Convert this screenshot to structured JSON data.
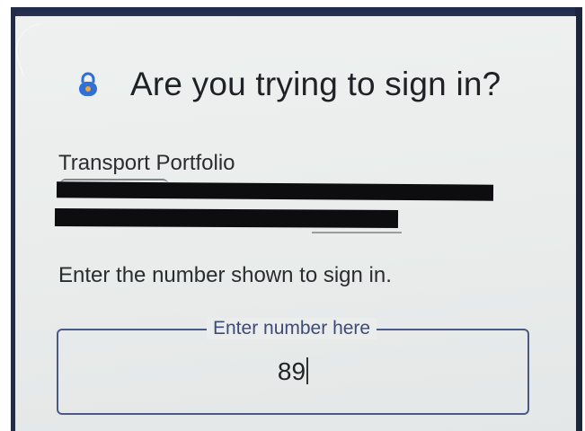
{
  "dialog": {
    "title": "Are you trying to sign in?",
    "lock_icon": "lock-shield-icon",
    "account": {
      "organization": "Transport Portfolio"
    },
    "instruction": "Enter the number shown to sign in.",
    "number_field": {
      "label": "Enter number here",
      "value": "89"
    }
  },
  "colors": {
    "accent": "#4a5a86",
    "icon_blue": "#2f6fd6",
    "icon_orange": "#f2a33a",
    "redaction": "#0d0d0f"
  }
}
